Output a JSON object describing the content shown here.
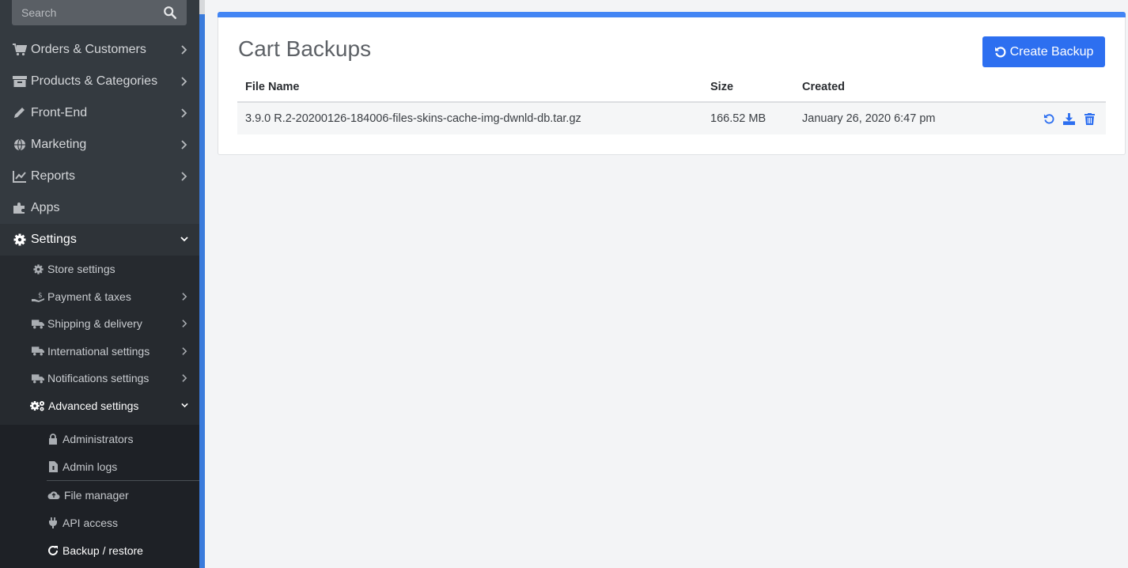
{
  "search": {
    "placeholder": "Search"
  },
  "nav": {
    "items": [
      {
        "label": "Orders & Customers",
        "icon": "cart-icon"
      },
      {
        "label": "Products & Categories",
        "icon": "box-icon"
      },
      {
        "label": "Front-End",
        "icon": "pen-icon"
      },
      {
        "label": "Marketing",
        "icon": "globe-icon"
      },
      {
        "label": "Reports",
        "icon": "chart-icon"
      },
      {
        "label": "Apps",
        "icon": "puzzle-icon"
      },
      {
        "label": "Settings",
        "icon": "gear-icon"
      }
    ],
    "settings_sub": [
      {
        "label": "Store settings",
        "icon": "gear-icon"
      },
      {
        "label": "Payment & taxes",
        "icon": "hand-dollar-icon"
      },
      {
        "label": "Shipping & delivery",
        "icon": "truck-icon"
      },
      {
        "label": "International settings",
        "icon": "truck-icon"
      },
      {
        "label": "Notifications settings",
        "icon": "truck-icon"
      },
      {
        "label": "Advanced settings",
        "icon": "gears-icon"
      }
    ],
    "advanced_sub": [
      {
        "label": "Administrators",
        "icon": "lock-icon"
      },
      {
        "label": "Admin logs",
        "icon": "file-icon"
      },
      {
        "label": "File manager",
        "icon": "cloud-icon"
      },
      {
        "label": "API access",
        "icon": "plug-icon"
      },
      {
        "label": "Backup / restore",
        "icon": "refresh-icon"
      }
    ]
  },
  "main": {
    "title": "Cart Backups",
    "create_button": "Create Backup",
    "table": {
      "headers": [
        "File Name",
        "Size",
        "Created"
      ],
      "rows": [
        {
          "file_name": "3.9.0 R.2-20200126-184006-files-skins-cache-img-dwnld-db.tar.gz",
          "size": "166.52 MB",
          "created": "January 26, 2020 6:47 pm"
        }
      ]
    }
  },
  "colors": {
    "accent": "#2d6ff0",
    "sidebar": "#343a40",
    "icon_action": "#2d6ff0"
  }
}
